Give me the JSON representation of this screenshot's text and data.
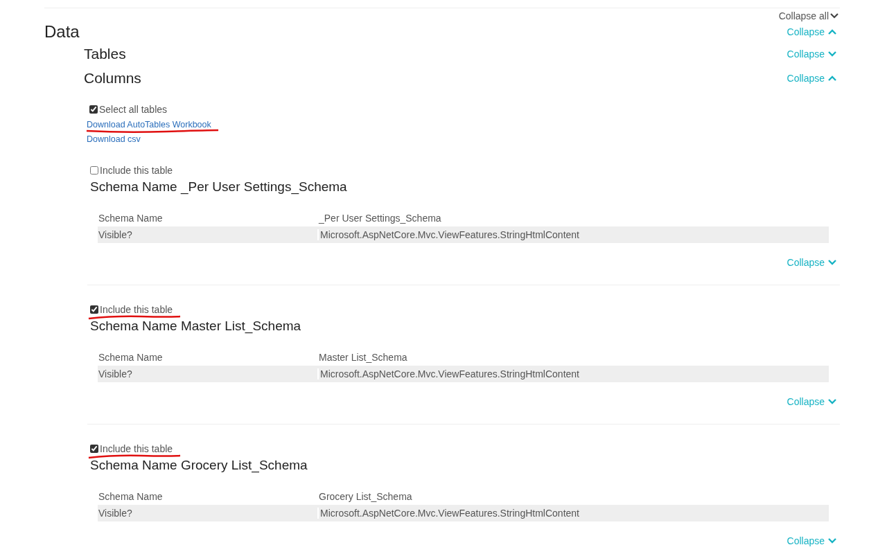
{
  "collapse_all": {
    "label": "Collapse all",
    "expanded": false
  },
  "sections": [
    {
      "title": "Data",
      "kind": "main",
      "toggle": {
        "label": "Collapse",
        "expanded": true
      }
    },
    {
      "title": "Tables",
      "kind": "sub",
      "toggle": {
        "label": "Collapse",
        "expanded": false
      }
    },
    {
      "title": "Columns",
      "kind": "sub",
      "toggle": {
        "label": "Collapse",
        "expanded": true
      }
    }
  ],
  "select_all": {
    "label": "Select all tables",
    "checked": true
  },
  "links": [
    {
      "label": "Download AutoTables Workbook",
      "annotated": true
    },
    {
      "label": "Download csv",
      "annotated": false
    }
  ],
  "tables": [
    {
      "include": {
        "label": "Include this table",
        "checked": false,
        "annotated": false
      },
      "heading": "Schema Name _Per User Settings_Schema",
      "rows": [
        [
          "Schema Name",
          "_Per User Settings_Schema"
        ],
        [
          "Visible?",
          "Microsoft.AspNetCore.Mvc.ViewFeatures.StringHtmlContent"
        ]
      ],
      "toggle": {
        "label": "Collapse",
        "expanded": false
      }
    },
    {
      "include": {
        "label": "Include this table",
        "checked": true,
        "annotated": true
      },
      "heading": "Schema Name Master List_Schema",
      "rows": [
        [
          "Schema Name",
          "Master List_Schema"
        ],
        [
          "Visible?",
          "Microsoft.AspNetCore.Mvc.ViewFeatures.StringHtmlContent"
        ]
      ],
      "toggle": {
        "label": "Collapse",
        "expanded": false
      }
    },
    {
      "include": {
        "label": "Include this table",
        "checked": true,
        "annotated": true
      },
      "heading": "Schema Name Grocery List_Schema",
      "rows": [
        [
          "Schema Name",
          "Grocery List_Schema"
        ],
        [
          "Visible?",
          "Microsoft.AspNetCore.Mvc.ViewFeatures.StringHtmlContent"
        ]
      ],
      "toggle": {
        "label": "Collapse",
        "expanded": false
      }
    }
  ]
}
